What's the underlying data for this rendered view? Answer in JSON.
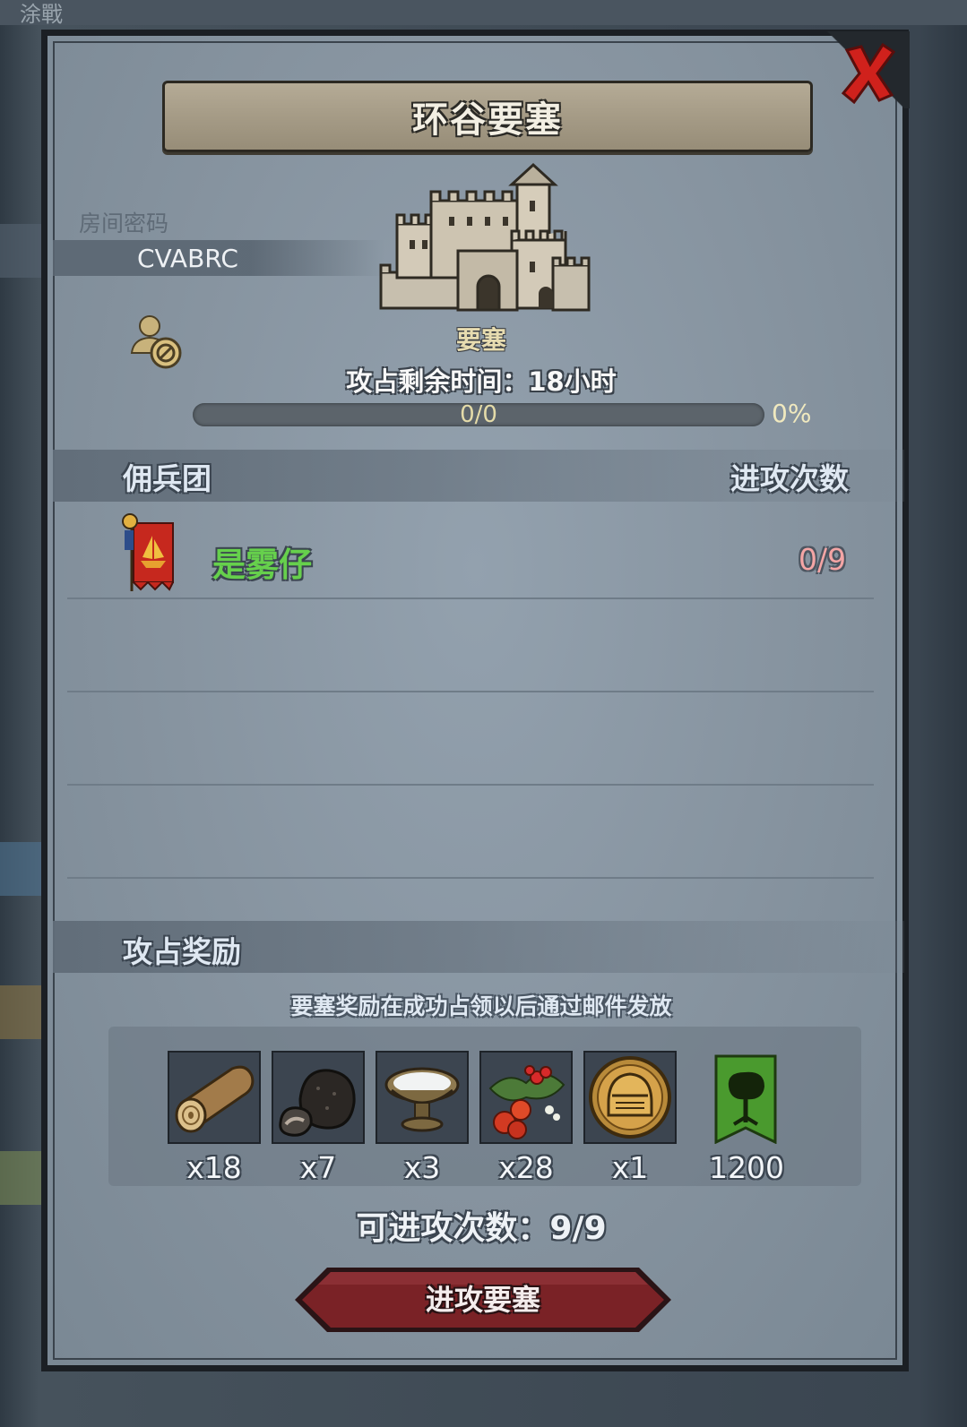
{
  "window": {
    "title": "环谷要塞"
  },
  "background": {
    "top_fragment": "涂戰"
  },
  "room": {
    "password_label": "房间密码",
    "password_value": "CVABRC"
  },
  "fortress": {
    "type_label": "要塞",
    "timer_label": "攻占剩余时间：",
    "timer_value": "18小时",
    "progress_text": "0/0",
    "progress_percent_text": "0%",
    "progress_fraction": 0
  },
  "mercenaries": {
    "header_left": "佣兵团",
    "header_right": "进攻次数",
    "rows": [
      {
        "name": "是雾仔",
        "attacks": "0/9",
        "name_color": "#66d04c",
        "attacks_color": "#f4a5a5"
      }
    ]
  },
  "rewards": {
    "header": "攻占奖励",
    "note": "要塞奖励在成功占领以后通过邮件发放",
    "items": [
      {
        "icon": "wood-log-icon",
        "qty": "x18"
      },
      {
        "icon": "truffle-icon",
        "qty": "x7"
      },
      {
        "icon": "milk-bowl-icon",
        "qty": "x3"
      },
      {
        "icon": "berries-icon",
        "qty": "x28"
      },
      {
        "icon": "knight-helmet-medal-icon",
        "qty": "x1"
      },
      {
        "icon": "green-tree-banner-icon",
        "qty": "1200"
      }
    ]
  },
  "footer": {
    "attempts_label": "可进攻次数：",
    "attempts_value": "9/9",
    "attack_button": "进攻要塞"
  },
  "colors": {
    "panel_bg": "#86939f",
    "title_banner": "#a59b86",
    "close_red": "#d0211c",
    "attack_button": "#7a2226",
    "merc_name": "#66d04c",
    "attack_count": "#f4a5a5"
  }
}
